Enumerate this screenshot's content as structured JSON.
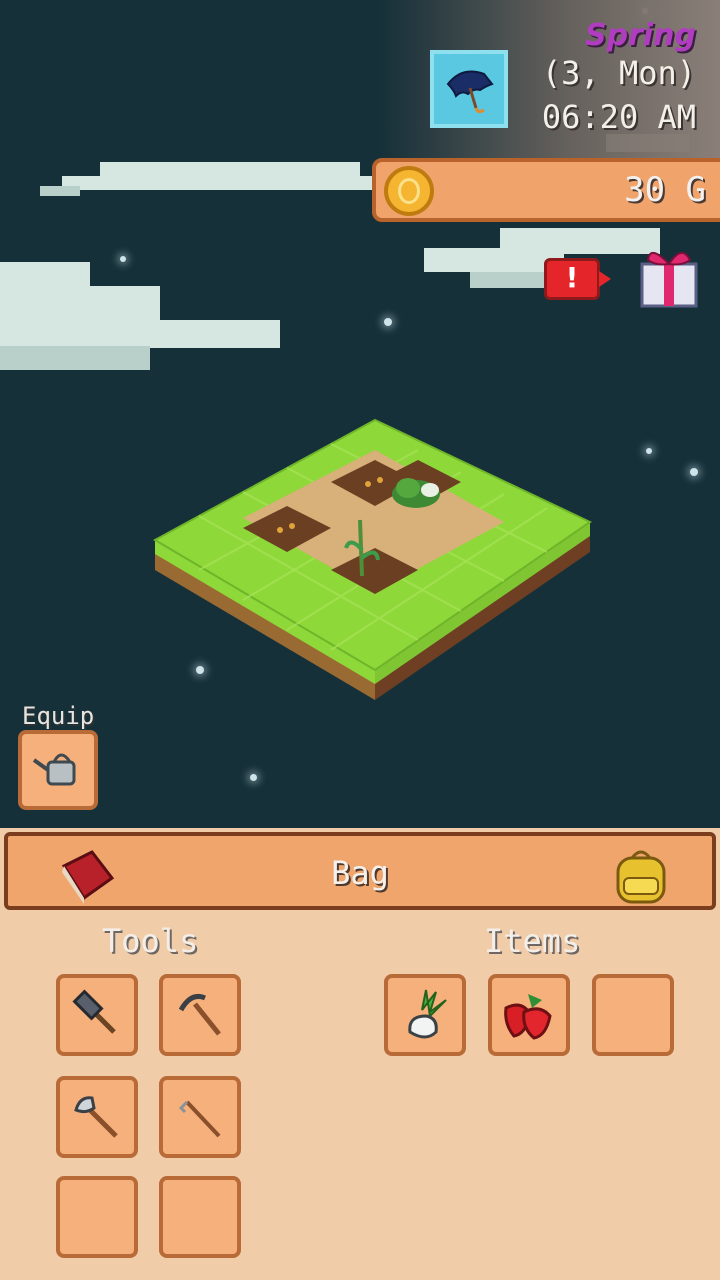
{
  "hud": {
    "season": "Spring",
    "date": "(3, Mon)",
    "time": "06:20 AM",
    "weather_icon": "umbrella-icon",
    "gold": "30 G"
  },
  "equip": {
    "label": "Equip",
    "equipped_icon": "watering-can-icon"
  },
  "bag": {
    "title": "Bag",
    "tools_label": "Tools",
    "items_label": "Items",
    "tools": [
      "hammer-icon",
      "sickle-icon",
      "axe-icon",
      "hoe-icon",
      "",
      ""
    ],
    "items": [
      "turnip-icon",
      "strawberry-icon",
      ""
    ]
  },
  "colors": {
    "sky": "#163039",
    "panel": "#f1cca9",
    "slot": "#f6b07c",
    "slot_border": "#b86a37",
    "season_text": "#b03cc0",
    "grass": "#8fd83a"
  }
}
